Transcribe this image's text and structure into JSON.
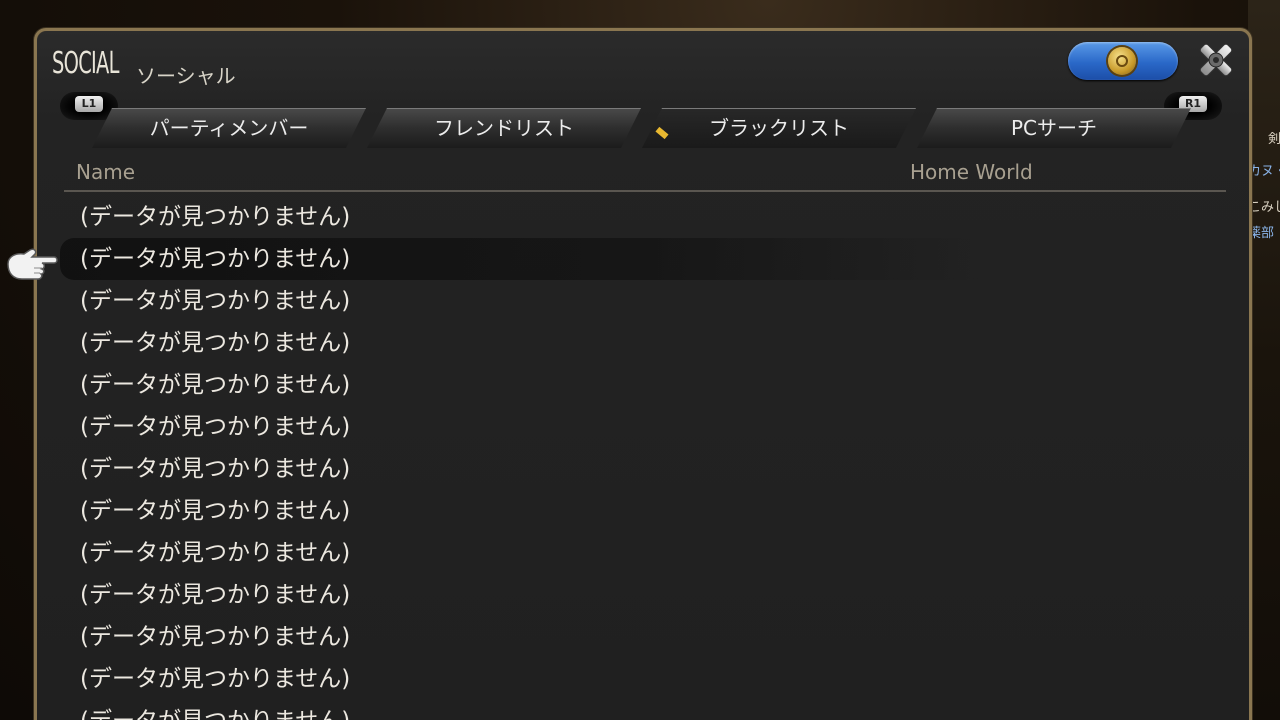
{
  "window": {
    "title_en": "SOCIAL",
    "title_jp": "ソーシャル"
  },
  "triggers": {
    "left": "L1",
    "right": "R1"
  },
  "tabs": [
    {
      "label": "パーティメンバー",
      "active": false
    },
    {
      "label": "フレンドリスト",
      "active": false
    },
    {
      "label": "ブラックリスト",
      "active": true
    },
    {
      "label": "PCサーチ",
      "active": false
    }
  ],
  "columns": {
    "name": "Name",
    "home_world": "Home World"
  },
  "rows": [
    "(データが見つかりません)",
    "(データが見つかりません)",
    "(データが見つかりません)",
    "(データが見つかりません)",
    "(データが見つかりません)",
    "(データが見つかりません)",
    "(データが見つかりません)",
    "(データが見つかりません)",
    "(データが見つかりません)",
    "(データが見つかりません)",
    "(データが見つかりません)",
    "(データが見つかりません)",
    "(データが見つかりません)"
  ],
  "selected_row": 1,
  "background_side_text": [
    "剣",
    "カヌ・",
    "こみし",
    "薬部"
  ],
  "colors": {
    "frame_gold": "#8a7650",
    "world_button_blue": "#2a68c8",
    "active_tab_marker": "#e8b830"
  },
  "icons": {
    "world_button": "world-crest-icon",
    "close": "close-cross-icon",
    "cursor": "pointing-hand-icon"
  }
}
